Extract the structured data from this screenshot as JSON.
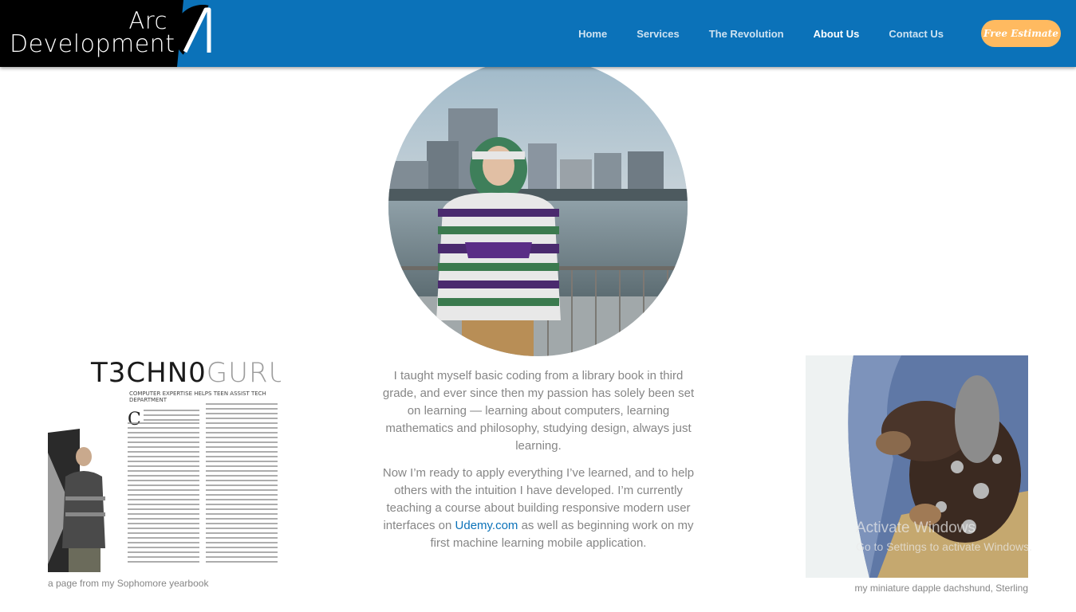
{
  "header": {
    "logo_line1": "Arc",
    "logo_line2": "Development",
    "tabs": [
      {
        "label": "Home"
      },
      {
        "label": "Services"
      },
      {
        "label": "The Revolution"
      },
      {
        "label": "About Us",
        "active": true
      },
      {
        "label": "Contact Us"
      }
    ],
    "cta_label": "Free Estimate"
  },
  "bio": {
    "paragraph1": "I taught myself basic coding from a library book in third grade, and ever since then my passion has solely been set on learning — learning about computers, learning mathematics and philosophy, studying design, always just learning.",
    "paragraph2_before": "Now I’m ready to apply everything I’ve learned, and to help others with the intuition I have developed. I’m currently teaching a course about building responsive modern user interfaces on ",
    "paragraph2_link": "Udemy.com",
    "paragraph2_after": " as well as beginning work on my first machine learning mobile application."
  },
  "yearbook": {
    "title_dark": "T3CHN0",
    "title_light": "GURU",
    "subtitle": "COMPUTER EXPERTISE HELPS TEEN ASSIST TECH DEPARTMENT",
    "dropcap": "C",
    "caption": "a page from my Sophomore yearbook"
  },
  "puppy": {
    "caption": "my miniature dapple dachshund, Sterling"
  },
  "watermark": {
    "line1": "Activate Windows",
    "line2": "Go to Settings to activate Windows."
  },
  "colors": {
    "blue": "#0b72b9",
    "orange": "#ffba60",
    "grey_text": "#868686"
  }
}
